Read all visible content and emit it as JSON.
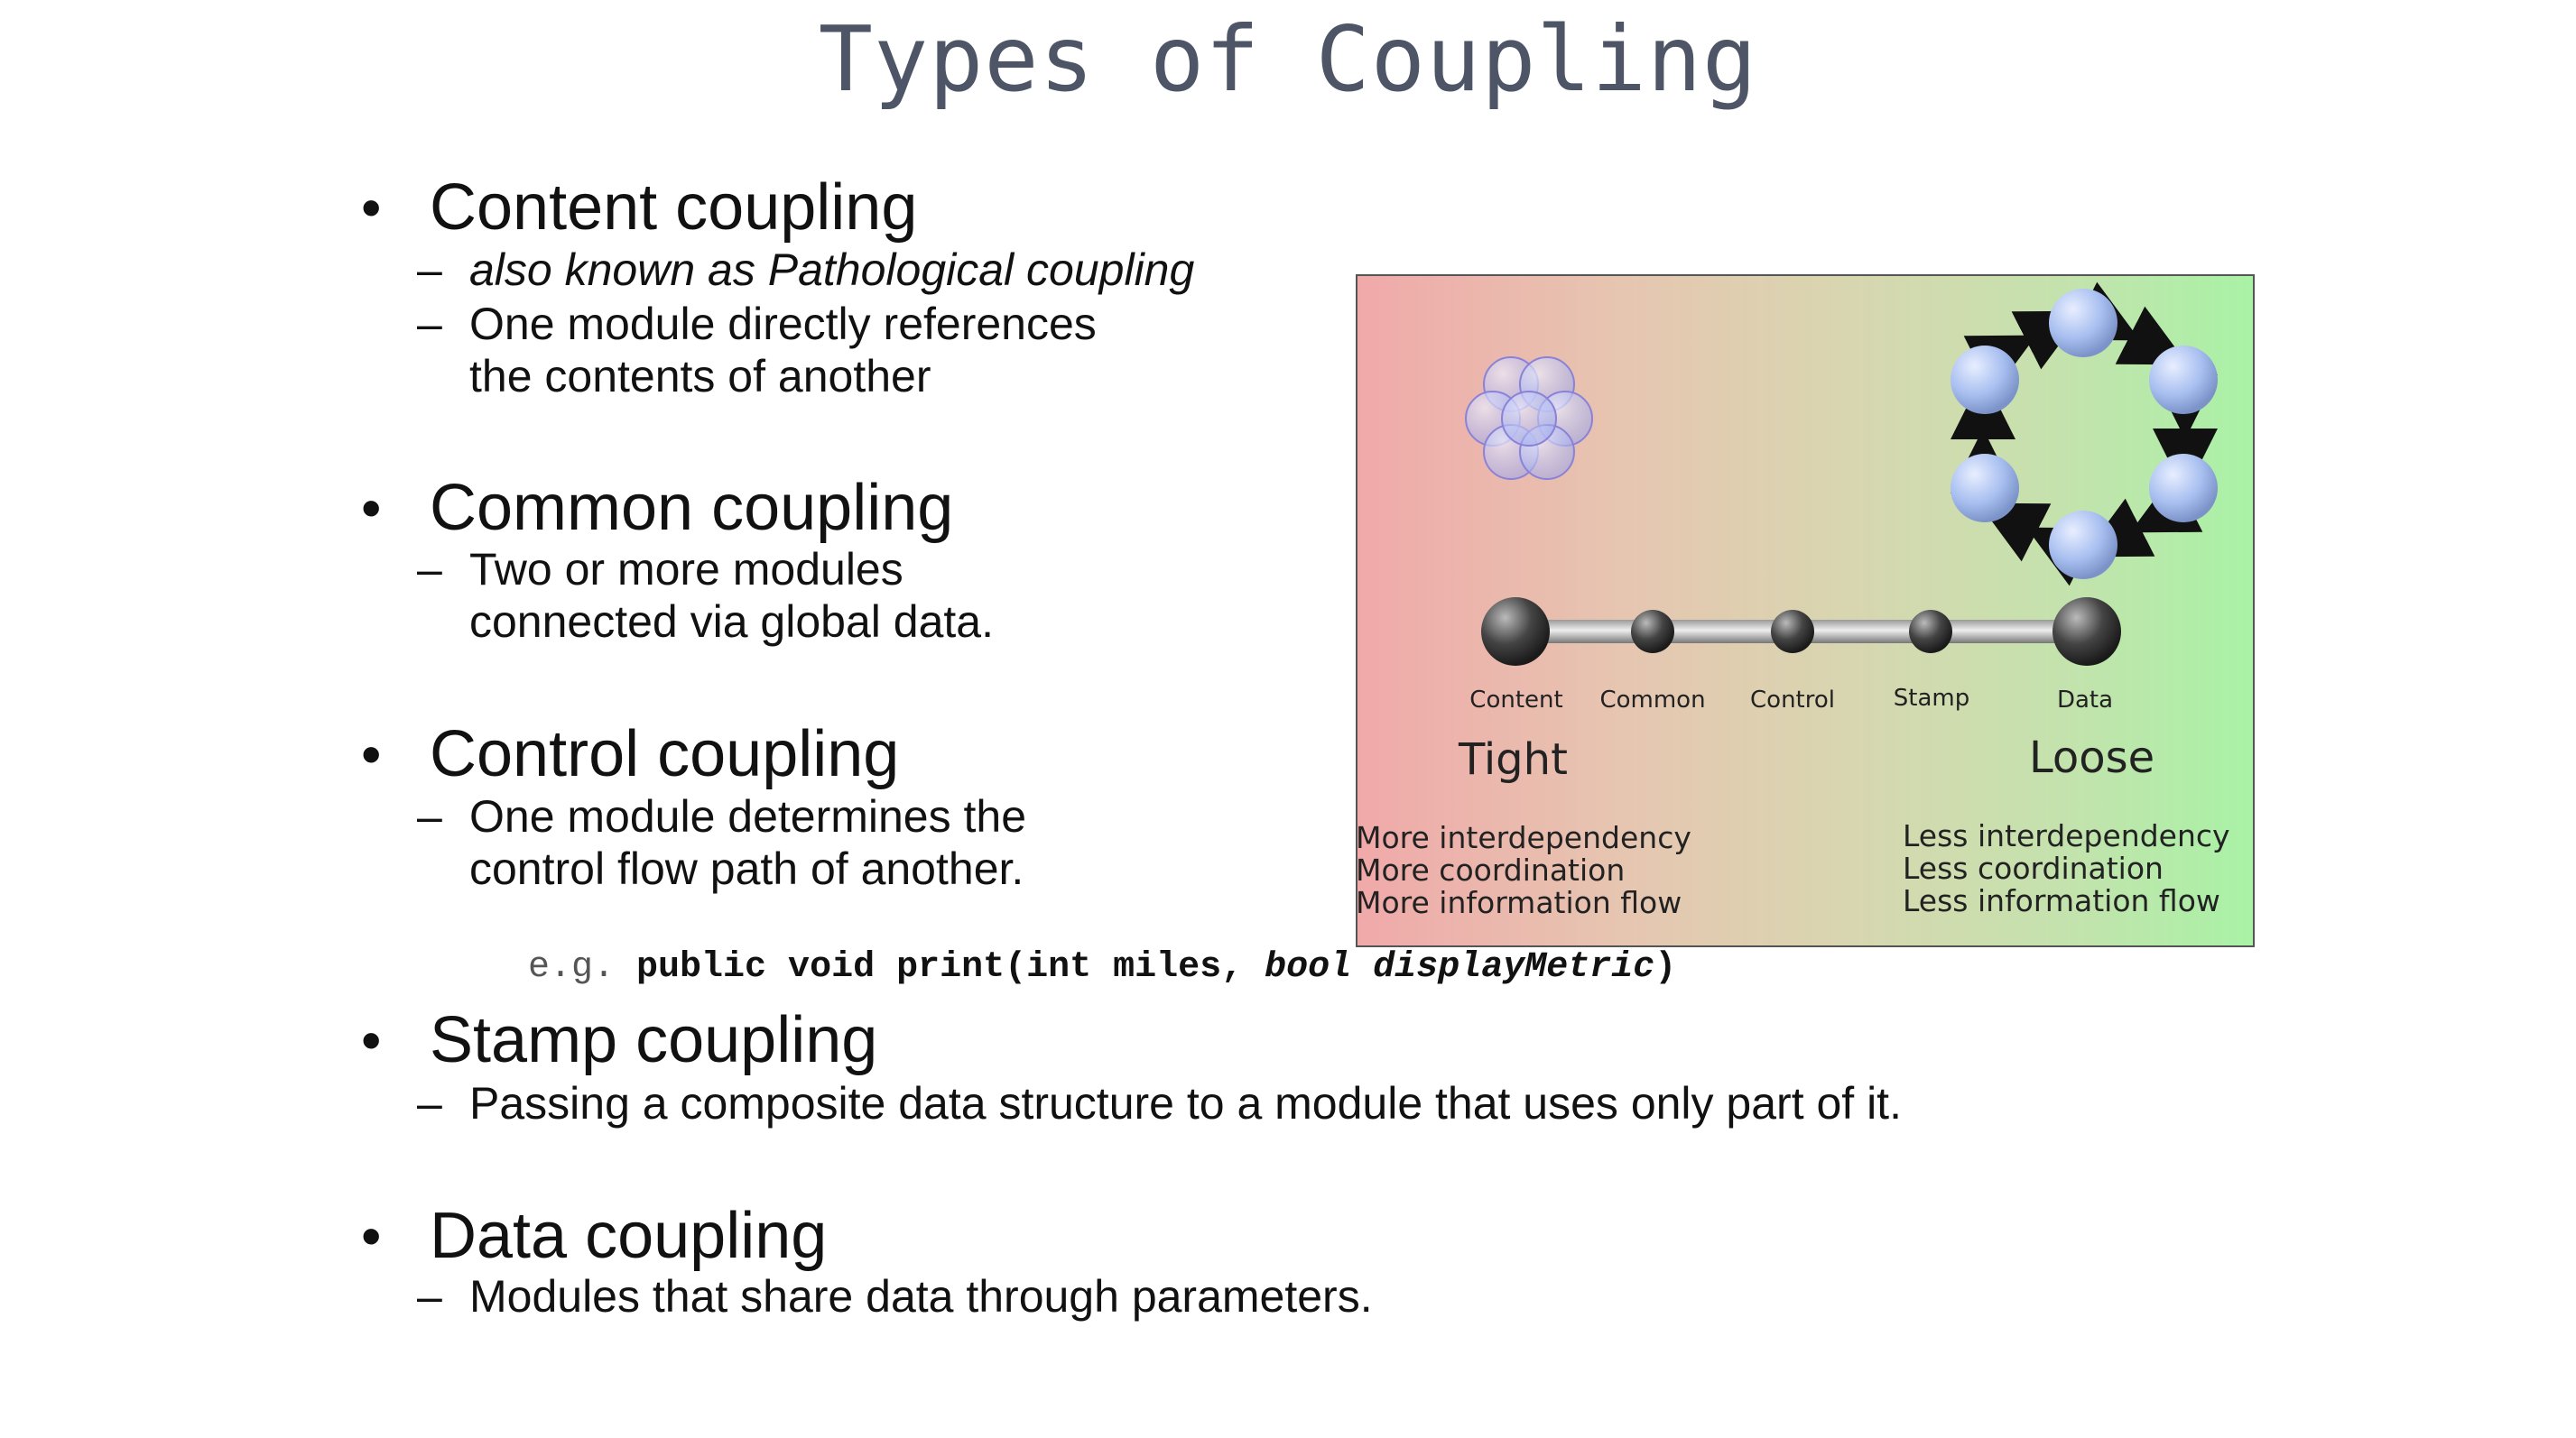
{
  "slide": {
    "title": "Types of Coupling",
    "bullet_symbol": "•",
    "dash_symbol": "–",
    "content": {
      "heading": "Content coupling",
      "aka": "also known as Pathological coupling",
      "desc_line1": "One module directly references",
      "desc_line2": "the contents of another"
    },
    "common": {
      "heading": "Common coupling",
      "desc_line1": "Two or more modules",
      "desc_line2": "connected via global data."
    },
    "control": {
      "heading": "Control coupling",
      "desc_line1": "One module determines the",
      "desc_line2": "control flow path of another.",
      "example_prefix": "e.g.",
      "example_signature": "public void print(int miles,",
      "example_arg": "bool displayMetric",
      "example_close": ")"
    },
    "stamp": {
      "heading": "Stamp coupling",
      "desc": "Passing a composite data structure to a module that uses only part of it."
    },
    "data": {
      "heading": "Data coupling",
      "desc": "Modules that share data through parameters."
    }
  },
  "diagram": {
    "scale_labels": [
      "Content",
      "Common",
      "Control",
      "Stamp",
      "Data"
    ],
    "tight_label": "Tight",
    "loose_label": "Loose",
    "tight_desc": [
      "More interdependency",
      "More coordination",
      "More information flow"
    ],
    "loose_desc": [
      "Less interdependency",
      "Less coordination",
      "Less information flow"
    ],
    "colors": {
      "tight_bg": "#f0a9a9",
      "loose_bg": "#a9f2a6",
      "sphere": "#a8bff0",
      "node": "#333333"
    }
  }
}
